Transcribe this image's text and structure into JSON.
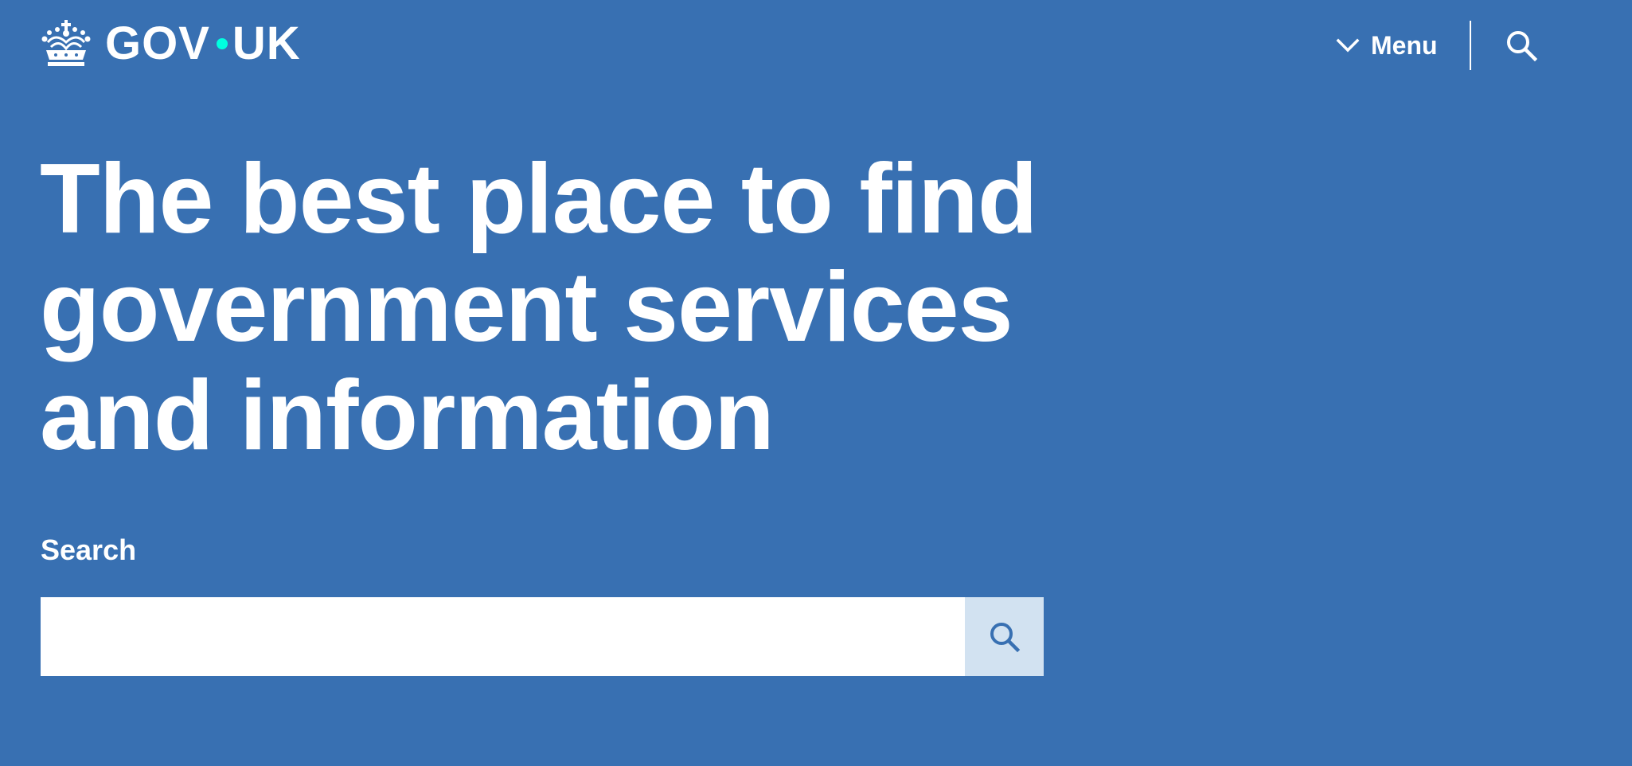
{
  "header": {
    "logo_text_left": "GOV",
    "logo_text_right": "UK",
    "menu_label": "Menu",
    "icons": [
      "crown-icon",
      "chevron-down-icon",
      "search-icon"
    ]
  },
  "hero": {
    "headline": "The best place to find government services and information"
  },
  "search": {
    "label": "Search",
    "value": "",
    "placeholder": ""
  },
  "colors": {
    "background": "#3870b2",
    "text": "#ffffff",
    "logo_dot": "#00ffe0",
    "search_button_bg": "#d2e2f1",
    "search_button_icon": "#3870b2"
  }
}
